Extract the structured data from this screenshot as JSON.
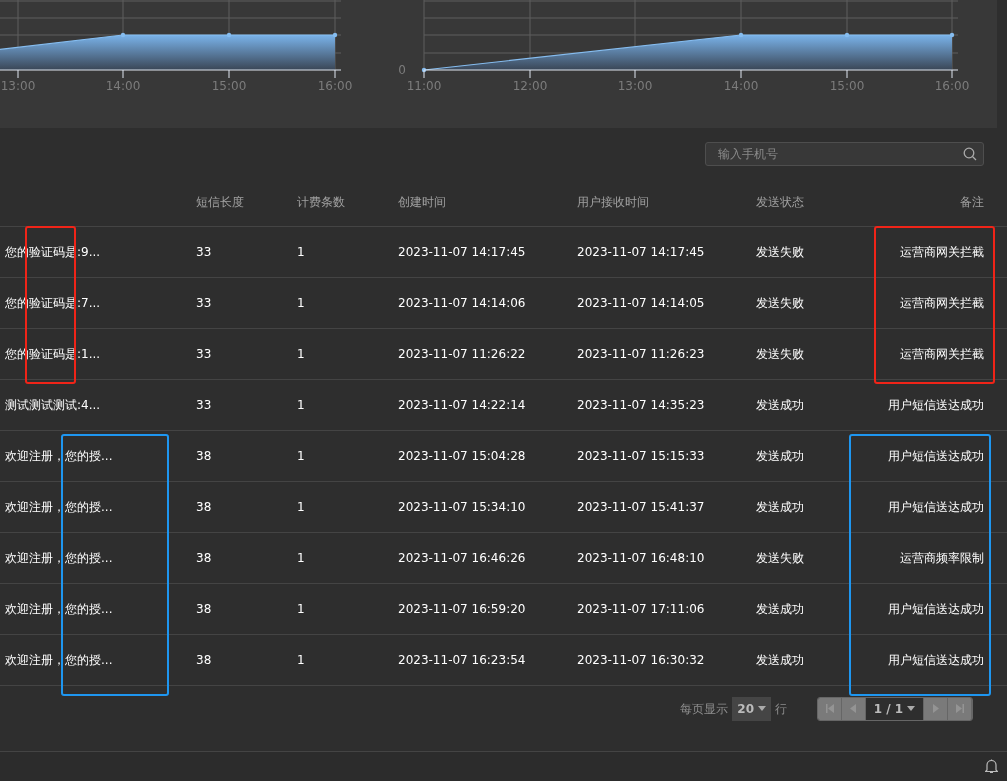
{
  "charts": [
    {
      "x_labels": [
        "13:00",
        "14:00",
        "15:00",
        "16:00"
      ]
    },
    {
      "y_labels": [
        "0"
      ],
      "x_labels": [
        "11:00",
        "12:00",
        "13:00",
        "14:00",
        "15:00",
        "16:00"
      ]
    }
  ],
  "search": {
    "placeholder": "输入手机号"
  },
  "table": {
    "columns": [
      "短信长度",
      "计费条数",
      "创建时间",
      "用户接收时间",
      "发送状态",
      "备注"
    ],
    "rows": [
      {
        "content": "您的验证码是:9...",
        "length": "33",
        "count": "1",
        "created": "2023-11-07 14:17:45",
        "received": "2023-11-07 14:17:45",
        "status": "发送失败",
        "remark": "运营商网关拦截"
      },
      {
        "content": "您的验证码是:7...",
        "length": "33",
        "count": "1",
        "created": "2023-11-07 14:14:06",
        "received": "2023-11-07 14:14:05",
        "status": "发送失败",
        "remark": "运营商网关拦截"
      },
      {
        "content": "您的验证码是:1...",
        "length": "33",
        "count": "1",
        "created": "2023-11-07 11:26:22",
        "received": "2023-11-07 11:26:23",
        "status": "发送失败",
        "remark": "运营商网关拦截"
      },
      {
        "content": "测试测试测试:4...",
        "length": "33",
        "count": "1",
        "created": "2023-11-07 14:22:14",
        "received": "2023-11-07 14:35:23",
        "status": "发送成功",
        "remark": "用户短信送达成功"
      },
      {
        "content": "欢迎注册，您的授...",
        "length": "38",
        "count": "1",
        "created": "2023-11-07 15:04:28",
        "received": "2023-11-07 15:15:33",
        "status": "发送成功",
        "remark": "用户短信送达成功"
      },
      {
        "content": "欢迎注册，您的授...",
        "length": "38",
        "count": "1",
        "created": "2023-11-07 15:34:10",
        "received": "2023-11-07 15:41:37",
        "status": "发送成功",
        "remark": "用户短信送达成功"
      },
      {
        "content": "欢迎注册，您的授...",
        "length": "38",
        "count": "1",
        "created": "2023-11-07 16:46:26",
        "received": "2023-11-07 16:48:10",
        "status": "发送失败",
        "remark": "运营商频率限制"
      },
      {
        "content": "欢迎注册，您的授...",
        "length": "38",
        "count": "1",
        "created": "2023-11-07 16:59:20",
        "received": "2023-11-07 17:11:06",
        "status": "发送成功",
        "remark": "用户短信送达成功"
      },
      {
        "content": "欢迎注册，您的授...",
        "length": "38",
        "count": "1",
        "created": "2023-11-07 16:23:54",
        "received": "2023-11-07 16:30:32",
        "status": "发送成功",
        "remark": "用户短信送达成功"
      }
    ]
  },
  "annotation_boxes": [
    {
      "color": "#f02418"
    },
    {
      "color": "#f02418"
    },
    {
      "color": "#1e96f0"
    },
    {
      "color": "#1e96f0"
    }
  ],
  "pagination": {
    "per_page_label": "每页显示",
    "per_page": "20",
    "rows_label": "行",
    "page": "1 / 1",
    "first_disabled": true,
    "prev_disabled": true,
    "next_disabled": true,
    "last_disabled": true
  }
}
